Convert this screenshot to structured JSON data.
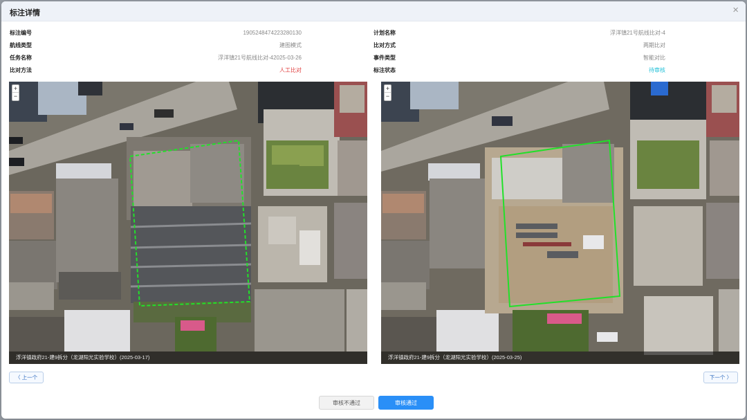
{
  "modal": {
    "title": "标注详情",
    "close_icon": "close-icon"
  },
  "info_left": [
    {
      "label": "标注编号",
      "value": "1905248474223280130",
      "tone": "normal"
    },
    {
      "label": "航线类型",
      "value": "建图模式",
      "tone": "normal"
    },
    {
      "label": "任务名称",
      "value": "浮洋镇21号航线比对-42025-03-26",
      "tone": "normal"
    },
    {
      "label": "比对方法",
      "value": "人工比对",
      "tone": "red"
    }
  ],
  "info_right": [
    {
      "label": "计划名称",
      "value": "浮洋镇21号航线比对-4",
      "tone": "normal"
    },
    {
      "label": "比对方式",
      "value": "两期比对",
      "tone": "normal"
    },
    {
      "label": "事件类型",
      "value": "智能对比",
      "tone": "normal"
    },
    {
      "label": "标注状态",
      "value": "待审核",
      "tone": "cyan"
    }
  ],
  "panels": {
    "left": {
      "caption": "浮洋镇政府21-建9拆分（龙湖阳光实验学校）(2025-03-17)",
      "zoom_in": "+",
      "zoom_out": "−"
    },
    "right": {
      "caption": "浮洋镇政府21-建9拆分（龙湖阳光实验学校）(2025-03-25)",
      "zoom_in": "+",
      "zoom_out": "−"
    }
  },
  "nav": {
    "prev": "〈 上一个",
    "next": "下一个 〉"
  },
  "footer": {
    "reject": "审核不通过",
    "approve": "审核通过"
  },
  "colors": {
    "accent": "#2a8ff7",
    "status_pending": "#22c0d8",
    "method_red": "#e04040",
    "annotation_green": "#22e02a"
  }
}
